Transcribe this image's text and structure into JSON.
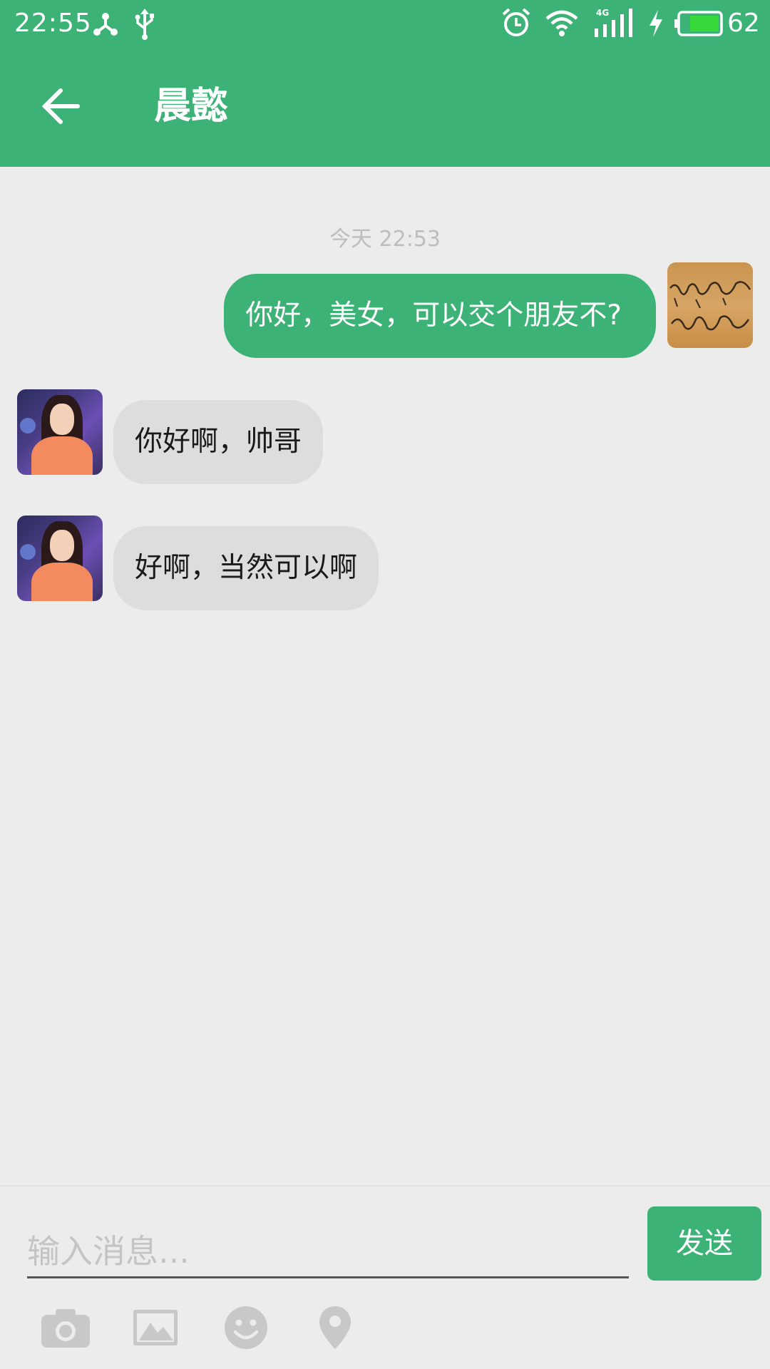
{
  "status_bar": {
    "time": "22:55",
    "battery_level": "62",
    "network_type": "4G",
    "icons": [
      "share-hub-icon",
      "usb-icon",
      "alarm-icon",
      "wifi-icon",
      "signal-icon",
      "charging-icon",
      "battery-icon"
    ]
  },
  "header": {
    "title": "晨懿",
    "back_icon": "arrow-left-icon"
  },
  "chat": {
    "timestamp": "今天 22:53",
    "messages": [
      {
        "direction": "outgoing",
        "text": "你好，美女，可以交个朋友不?"
      },
      {
        "direction": "incoming",
        "text": "你好啊，帅哥"
      },
      {
        "direction": "incoming",
        "text": "好啊，当然可以啊"
      }
    ]
  },
  "composer": {
    "placeholder": "输入消息...",
    "value": "",
    "send_label": "发送",
    "tools": [
      "camera-icon",
      "image-icon",
      "emoji-icon",
      "location-icon"
    ]
  },
  "colors": {
    "brand_green": "#3db276",
    "background": "#ececec",
    "incoming_bubble": "#dddddd",
    "icon_gray": "#c8c8c8"
  }
}
